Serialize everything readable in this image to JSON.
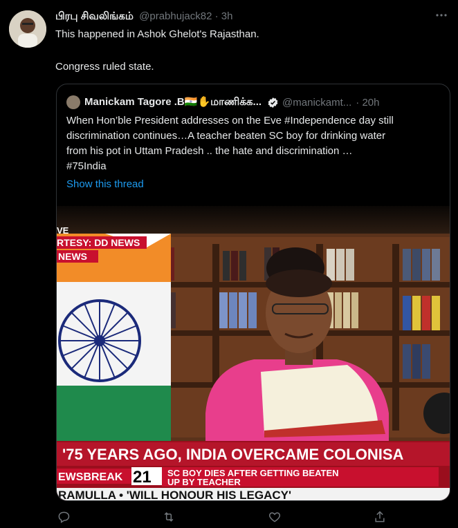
{
  "tweet": {
    "display_name": "பிரபு சிவலிங்கம்",
    "handle": "@prabhujack82",
    "separator": "·",
    "time": "3h",
    "line1": "This happened in Ashok Ghelot's Rajasthan.",
    "line2": "Congress ruled state."
  },
  "quoted": {
    "display_name": "Manickam Tagore .B🇮🇳✋மாணிக்க...",
    "handle": "@manickamt...",
    "time": "· 20h",
    "text_lines": [
      "When Hon’ble President addresses on the Eve #Independence day still",
      "discrimination continues…A teacher beaten SC boy for drinking water",
      "from his pot in Uttam Pradesh .. the hate and discrimination …",
      "#75India"
    ],
    "show_thread": "Show this thread"
  },
  "media": {
    "corner_line1": "VE",
    "corner_line2": "RTESY: DD NEWS",
    "corner_line3": "NEWS",
    "ticker_main": "'75 YEARS AGO, INDIA OVERCAME COLONISA",
    "newsbreak_label": "EWSBREAK",
    "channel_number": "21",
    "headline_line1": "SC BOY DIES AFTER GETTING BEATEN",
    "headline_line2": "UP BY TEACHER",
    "bottom_ticker": "RAMULLA • 'WILL HONOUR HIS LEGACY'"
  },
  "actions": [
    "reply-icon",
    "retweet-icon",
    "like-icon",
    "share-icon"
  ],
  "colors": {
    "link": "#1d9bf0",
    "muted": "#71767b",
    "bg": "#000000",
    "ticker_red": "#c8102e"
  }
}
